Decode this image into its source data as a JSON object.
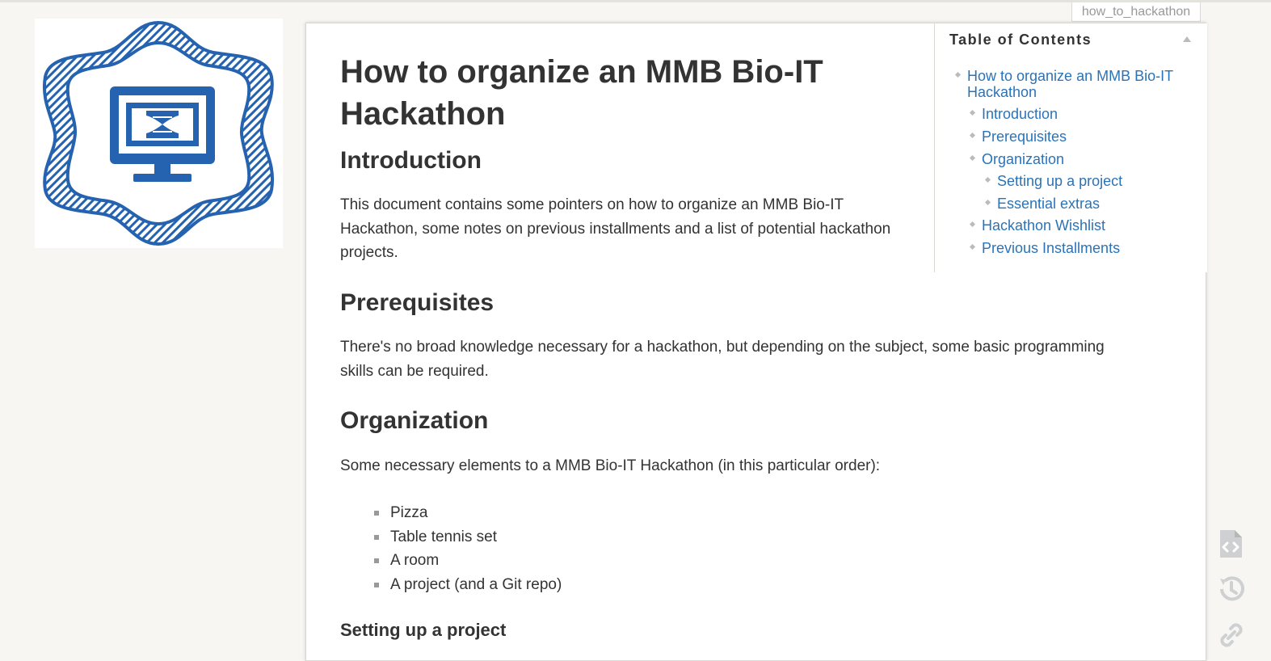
{
  "page_id": "how_to_hackathon",
  "doc": {
    "title": "How to organize an MMB Bio-IT Hackathon",
    "intro_heading": "Introduction",
    "intro_text": "This document contains some pointers on how to organize an MMB Bio-IT Hackathon, some notes on previous installments and a list of potential hackathon projects.",
    "prereq_heading": "Prerequisites",
    "prereq_text": "There's no broad knowledge necessary for a hackathon, but depending on the subject, some basic programming skills can be required.",
    "org_heading": "Organization",
    "org_text": "Some necessary elements to a MMB Bio-IT Hackathon (in this particular order):",
    "org_items": [
      "Pizza",
      "Table tennis set",
      "A room",
      "A project (and a Git repo)"
    ],
    "setup_heading": "Setting up a project"
  },
  "toc": {
    "title": "Table of Contents",
    "items": [
      {
        "label": "How to organize an MMB Bio-IT Hackathon"
      },
      {
        "label": "Introduction"
      },
      {
        "label": "Prerequisites"
      },
      {
        "label": "Organization"
      },
      {
        "label": "Setting up a project"
      },
      {
        "label": "Essential extras"
      },
      {
        "label": "Hackathon Wishlist"
      },
      {
        "label": "Previous Installments"
      }
    ]
  },
  "page_tools": [
    {
      "icon": "show-source-icon"
    },
    {
      "icon": "old-revisions-icon"
    },
    {
      "icon": "backlinks-icon"
    }
  ],
  "colors": {
    "accent": "#2b73b7",
    "logo_blue": "#2563b0",
    "background": "#f7f6f3"
  }
}
